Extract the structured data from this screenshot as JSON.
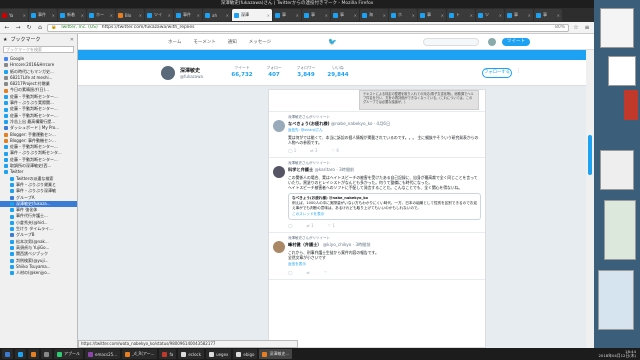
{
  "window": {
    "title": "深澤敏史(fukazawa)さん | Twitterからの連投付きマーク - Mozilla Firefox"
  },
  "tabs": [
    {
      "label": "Ya",
      "color": "#c00"
    },
    {
      "label": "事件",
      "color": "#1da1f2"
    },
    {
      "label": "新着",
      "color": "#1da1f2"
    },
    {
      "label": "ホー",
      "color": "#1da1f2"
    },
    {
      "label": "Blo",
      "color": "#e67e22"
    },
    {
      "label": "ツイ",
      "color": "#1da1f2"
    },
    {
      "label": "事件",
      "color": "#1da1f2"
    },
    {
      "label": "ah",
      "color": "#1da1f2"
    },
    {
      "label": "深澤",
      "color": "#1da1f2",
      "active": true
    },
    {
      "label": "事",
      "color": "#1da1f2"
    },
    {
      "label": "事",
      "color": "#1da1f2"
    },
    {
      "label": "事",
      "color": "#1da1f2"
    },
    {
      "label": "海",
      "color": "#1da1f2"
    },
    {
      "label": "ホ",
      "color": "#1da1f2"
    },
    {
      "label": "事",
      "color": "#1da1f2"
    },
    {
      "label": "ト",
      "color": "#1da1f2"
    },
    {
      "label": "ツ",
      "color": "#1da1f2"
    },
    {
      "label": "事",
      "color": "#1da1f2"
    },
    {
      "label": "事",
      "color": "#1da1f2"
    }
  ],
  "nav": {
    "url_org": "Twitter, Inc. (US)",
    "url": "https://twitter.com/fukazawa/with_replies",
    "zoom": "80%"
  },
  "sidebar": {
    "title": "ブックマーク",
    "search_placeholder": "ブックマークを検索",
    "items": [
      {
        "label": "Google",
        "color": "#4285f4"
      },
      {
        "label": "Hrrcore:2016&Hrrcore",
        "color": "#888"
      },
      {
        "label": "紙の時代にもマンガ史...",
        "color": "#1da1f2"
      },
      {
        "label": "68217Life at meshi...",
        "color": "#888"
      },
      {
        "label": "68217Project:付贈業",
        "color": "#888"
      },
      {
        "label": "今日の素晴過ぎ(日)...",
        "color": "#e67e22"
      },
      {
        "label": "佐藤・手動判断センター...",
        "color": "#1da1f2"
      },
      {
        "label": "事件・ぶりぶり実際関...",
        "color": "#1da1f2"
      },
      {
        "label": "佐藤・手動判断センター...",
        "color": "#1da1f2"
      },
      {
        "label": "佐藤・手動判断センター...",
        "color": "#1da1f2"
      },
      {
        "label": "冷苦上出 最高構築行提...",
        "color": "#1da1f2"
      },
      {
        "label": "ダッシュボード | My Pro...",
        "color": "#3a7bd5"
      },
      {
        "label": "Blogger: 手書運動セン...",
        "color": "#e67e22"
      },
      {
        "label": "Blogger: 事件動機セン...",
        "color": "#e67e22"
      },
      {
        "label": "佐藤・手動判断センター...",
        "color": "#1da1f2"
      },
      {
        "label": "事件・ぶりぶり判断センタ...",
        "color": "#1da1f2"
      },
      {
        "label": "佐藤・手動判断センター...",
        "color": "#1da1f2"
      },
      {
        "label": "取調所の深澤敏史(西...",
        "color": "#1da1f2"
      },
      {
        "label": "Twitter",
        "color": "#1da1f2"
      },
      {
        "label": "Twitterの派遣な検索",
        "color": "#1da1f2"
      },
      {
        "label": "事件・ぶりぶり貸業と",
        "color": "#1da1f2"
      },
      {
        "label": "事件・ぶりぶり深澤敏",
        "color": "#1da1f2"
      },
      {
        "label": "グループA",
        "color": "#3a7bd5"
      },
      {
        "label": "深澤敏史(fukaza...",
        "color": "#1da1f2",
        "selected": true
      },
      {
        "label": "事件 強化体",
        "color": "#1da1f2"
      },
      {
        "label": "事件代行弁護士...",
        "color": "#1da1f2"
      },
      {
        "label": "小倉秀夫(@hid...",
        "color": "#1da1f2"
      },
      {
        "label": "生けり タイムライ...",
        "color": "#1da1f2"
      },
      {
        "label": "グループB",
        "color": "#3a7bd5"
      },
      {
        "label": "松本次男(@nak...",
        "color": "#1da1f2"
      },
      {
        "label": "高須貞与 YujiGo...",
        "color": "#1da1f2"
      },
      {
        "label": "関西誘べジブック",
        "color": "#1da1f2"
      },
      {
        "label": "判例検索(@yuji...",
        "color": "#1da1f2"
      },
      {
        "label": "Shiiko Tsuyama...",
        "color": "#1da1f2"
      },
      {
        "label": "人材の(@kenjyo...",
        "color": "#1da1f2"
      }
    ]
  },
  "twitter": {
    "nav": [
      "ホーム",
      "モーメント",
      "通知",
      "メッセージ"
    ],
    "tweet_button": "ツイート",
    "profile": {
      "name": "深澤敏史",
      "handle": "@fukazawa",
      "follow_button": "フォローする",
      "stats": [
        {
          "label": "ツイート",
          "value": "66,732"
        },
        {
          "label": "フォロー",
          "value": "407"
        },
        {
          "label": "フォロワー",
          "value": "3,849"
        },
        {
          "label": "いいね",
          "value": "29,844"
        }
      ]
    },
    "image_caption": "テキストによる特定の整理を取り入れての対応(電子文書化等)。総務課でヘルプ件名を行い、方針の再評価ができなくなっている。(これについては、このグループでは必要な議論が。)",
    "tweets": [
      {
        "context": "深澤敏史さんがリツイート",
        "name": "なべきょう(お疲れ様)",
        "handle": "@nabe_nabekyo_ko · 4月6日",
        "reply_to": "返信先: @sinanjiさん",
        "text": "実は何がでは能くて、本当に訴訟の個人情報が掲載されているのです。。。 主に親族やそういう研究発表からの人物への参照です。",
        "avatar": "#9ab",
        "acts": [
          "◯ 1",
          "⇄ 3",
          "♡ 6"
        ]
      },
      {
        "context": "深澤敏史さんがリツイート",
        "name": "科学と弁護士",
        "handle": "@karitaro · 3時間前",
        "reply_to": "",
        "text": "この関係人の場合、実はヘイトスピーチの被害を受けたある自己記録に、自身が最高裁で全く同じことを言っていたり。黒塗りのヒレイシストがなんとも多かった。何うて整備にも時代になった。\nヘイトスピーチ被害者へのソフトに手配して発言することだ。こんなことでも、全く関心を得ないね。",
        "avatar": "#556",
        "quote_head": "なべきょう(お疲れ様) @nabe_nabekyo_ko",
        "quote": "例えば、1000人の中に実際量がいない方もわかりにくい時代。一方、日本の組織として性別を区別できるのでお迎え事がでも判断の意味は、あるけれども取り上げてもいいのかもしれないので。",
        "quote_link": "このスレッドを表示",
        "acts": [
          "◯",
          "⇄ 1",
          "♡ 1"
        ]
      },
      {
        "context": "深澤敏史さんがリツイート",
        "name": "峰村健（弁護士）",
        "handle": "@kiyo_chikyo · 3時間前",
        "reply_to": "",
        "text": "これから、刑事弁護士生徒から案件内容の報告です。\n全然文章が小さいです",
        "avatar": "#a86",
        "show_thread": "返信を表示",
        "acts": [
          "◯",
          "⇄",
          "♡"
        ]
      }
    ]
  },
  "status_url": "https://twitter.com/wata_nabekyo_ko/status/980096140043582177",
  "taskbar": {
    "items": [
      {
        "label": "",
        "color": "#3a7bd5"
      },
      {
        "label": "",
        "color": "#1da1f2"
      },
      {
        "label": "",
        "color": "#e67e22"
      },
      {
        "label": "",
        "color": "#888"
      },
      {
        "label": "アプール",
        "color": "#2ecc71"
      },
      {
        "label": "emacs25...",
        "color": "#8e44ad"
      },
      {
        "label": "_d_R(アー...",
        "color": "#e67e22"
      },
      {
        "label": "fa",
        "color": "#c0392b"
      },
      {
        "label": "eclock",
        "color": "#ddd"
      },
      {
        "label": "uegex",
        "color": "#ddd"
      },
      {
        "label": "ebigo",
        "color": "#ddd"
      },
      {
        "label": "深澤敏史...",
        "color": "#e67e22",
        "active": true
      }
    ],
    "time": "18:44",
    "date": "2018年04月12日(木)"
  }
}
